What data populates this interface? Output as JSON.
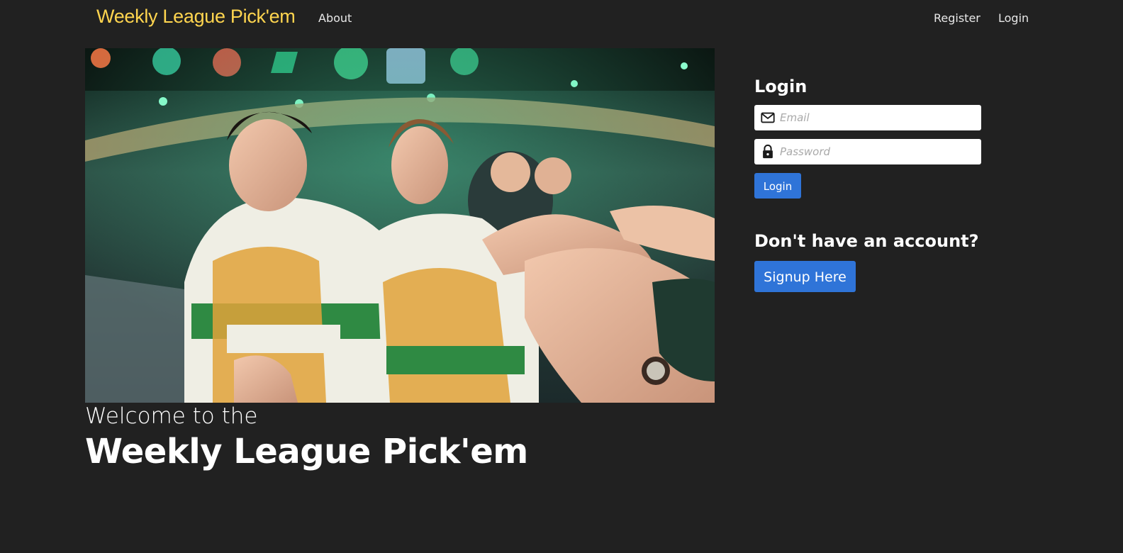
{
  "navbar": {
    "brand": "Weekly League Pick'em",
    "about": "About",
    "register": "Register",
    "login": "Login"
  },
  "hero": {
    "image_alt": "Players high-fiving fans at an esports arena",
    "welcome_line1": "Welcome to the",
    "welcome_line2": "Weekly League Pick'em"
  },
  "login_form": {
    "heading": "Login",
    "email_placeholder": "Email",
    "password_placeholder": "Password",
    "submit_label": "Login"
  },
  "signup": {
    "heading": "Don't have an account?",
    "button_label": "Signup Here"
  },
  "colors": {
    "background": "#212121",
    "brand": "#ffd54f",
    "primary_button": "#2f74d8"
  }
}
